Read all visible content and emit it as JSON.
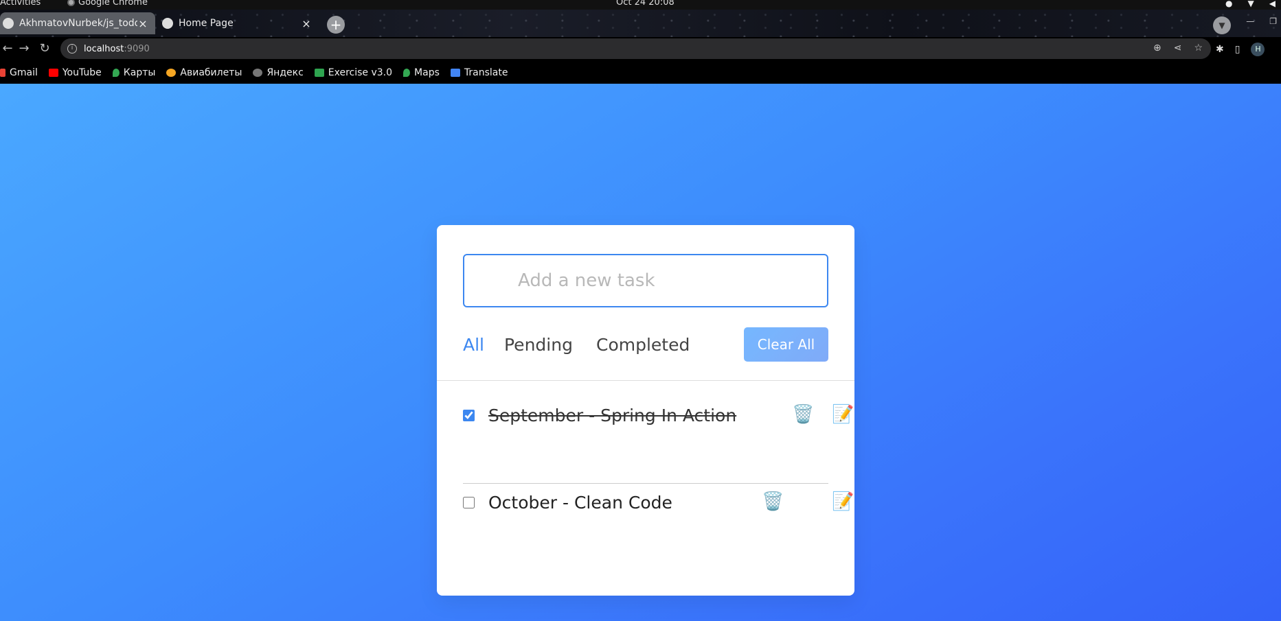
{
  "os_bar": {
    "activities": "Activities",
    "app_name": "Google Chrome",
    "clock": "Oct 24  20:08"
  },
  "browser": {
    "tabs": [
      {
        "title": "AkhmatovNurbek/js_todo",
        "favicon": "github-icon",
        "active": true
      },
      {
        "title": "Home Page",
        "favicon": "globe-icon",
        "active": false
      }
    ],
    "url_host": "localhost",
    "url_port": ":9090",
    "profile_initial": "H",
    "bookmarks": [
      {
        "label": "Gmail",
        "icon": "gmail-icon",
        "color": "#ea4335"
      },
      {
        "label": "YouTube",
        "icon": "youtube-icon",
        "color": "#ff0000"
      },
      {
        "label": "Карты",
        "icon": "maps-pin-icon",
        "color": "#34a853"
      },
      {
        "label": "Авиабилеты",
        "icon": "plane-icon",
        "color": "#f5a623"
      },
      {
        "label": "Яндекс",
        "icon": "globe-icon",
        "color": "#777777"
      },
      {
        "label": "Exercise v3.0",
        "icon": "w-logo-icon",
        "color": "#2ea44f"
      },
      {
        "label": "Maps",
        "icon": "maps-pin-icon",
        "color": "#34a853"
      },
      {
        "label": "Translate",
        "icon": "translate-icon",
        "color": "#4285f4"
      }
    ]
  },
  "todo": {
    "input_placeholder": "Add a new task",
    "input_value": "",
    "filters": [
      {
        "label": "All",
        "active": true
      },
      {
        "label": "Pending",
        "active": false
      },
      {
        "label": "Completed",
        "active": false
      }
    ],
    "clear_all_label": "Clear All",
    "tasks": [
      {
        "text": "September - Spring In Action",
        "completed": true,
        "delete_icon": "🗑️",
        "edit_icon": "📝"
      },
      {
        "text": "October - Clean Code",
        "completed": false,
        "delete_icon": "🗑️",
        "edit_icon": "📝"
      }
    ]
  },
  "colors": {
    "accent": "#3c87f0",
    "page_gradient_start": "#4aa8ff",
    "page_gradient_end": "#3462f8"
  }
}
